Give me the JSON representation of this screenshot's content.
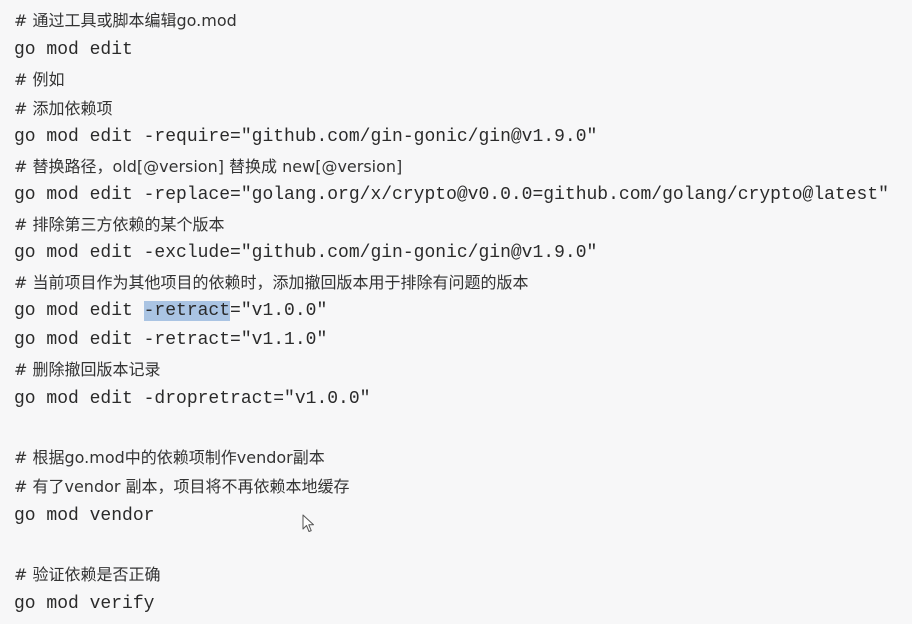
{
  "lines": [
    {
      "kind": "comment",
      "text": "# 通过工具或脚本编辑go.mod"
    },
    {
      "kind": "code",
      "text": "go mod edit"
    },
    {
      "kind": "comment",
      "text": "# 例如"
    },
    {
      "kind": "comment",
      "text": "# 添加依赖项"
    },
    {
      "kind": "code",
      "text": "go mod edit -require=\"github.com/gin-gonic/gin@v1.9.0\""
    },
    {
      "kind": "comment",
      "text": "# 替换路径，old[@version] 替换成 new[@version]"
    },
    {
      "kind": "code",
      "text": "go mod edit -replace=\"golang.org/x/crypto@v0.0.0=github.com/golang/crypto@latest\""
    },
    {
      "kind": "comment",
      "text": "# 排除第三方依赖的某个版本"
    },
    {
      "kind": "code",
      "text": "go mod edit -exclude=\"github.com/gin-gonic/gin@v1.9.0\""
    },
    {
      "kind": "comment",
      "text": "# 当前项目作为其他项目的依赖时，添加撤回版本用于排除有问题的版本"
    },
    {
      "kind": "code-highlight",
      "before": "go mod edit ",
      "highlight": "-retract",
      "after": "=\"v1.0.0\""
    },
    {
      "kind": "code",
      "text": "go mod edit -retract=\"v1.1.0\""
    },
    {
      "kind": "comment",
      "text": "# 删除撤回版本记录"
    },
    {
      "kind": "code",
      "text": "go mod edit -dropretract=\"v1.0.0\""
    },
    {
      "kind": "blank"
    },
    {
      "kind": "comment",
      "text": "# 根据go.mod中的依赖项制作vendor副本"
    },
    {
      "kind": "comment",
      "text": "# 有了vendor 副本，项目将不再依赖本地缓存"
    },
    {
      "kind": "code",
      "text": "go mod vendor"
    },
    {
      "kind": "blank"
    },
    {
      "kind": "comment",
      "text": "# 验证依赖是否正确"
    },
    {
      "kind": "code",
      "text": "go mod verify"
    }
  ],
  "colors": {
    "background": "#f7f7f8",
    "text": "#2a2a2a",
    "selection": "#aac4e3"
  },
  "icons": {
    "cursor": "mouse-pointer-icon"
  }
}
